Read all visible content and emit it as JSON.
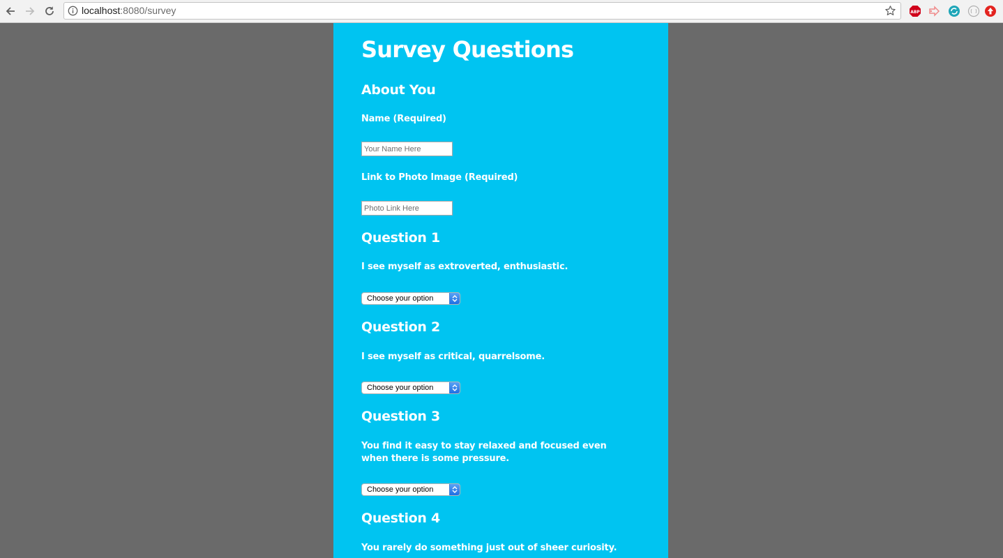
{
  "browser": {
    "url_host": "localhost",
    "url_rest": ":8080/survey",
    "extensions": [
      "adblock-plus-icon",
      "pink-arrow-extension-icon",
      "teal-sync-extension-icon",
      "gray-circle-extension-icon",
      "red-upload-extension-icon"
    ]
  },
  "page": {
    "title": "Survey Questions",
    "about": {
      "heading": "About You",
      "name_label": "Name (Required)",
      "name_placeholder": "Your Name Here",
      "photo_label": "Link to Photo Image (Required)",
      "photo_placeholder": "Photo Link Here"
    },
    "questions": [
      {
        "heading": "Question 1",
        "text": "I see myself as extroverted, enthusiastic.",
        "selected": "Choose your option"
      },
      {
        "heading": "Question 2",
        "text": "I see myself as critical, quarrelsome.",
        "selected": "Choose your option"
      },
      {
        "heading": "Question 3",
        "text": "You find it easy to stay relaxed and focused even when there is some pressure.",
        "selected": "Choose your option"
      },
      {
        "heading": "Question 4",
        "text": "You rarely do something just out of sheer curiosity."
      }
    ]
  },
  "colors": {
    "panel": "#00c4f1",
    "backdrop": "#6a6a6a",
    "text": "#ffffff"
  }
}
